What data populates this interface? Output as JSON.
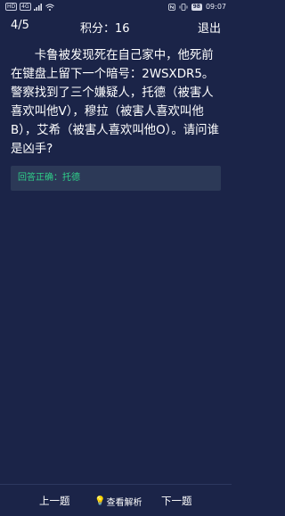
{
  "status_bar": {
    "left_tags": [
      "HD",
      "4G"
    ],
    "signal_icon": "signal-bars-icon",
    "wifi_icon": "wifi-icon",
    "nfc_icon": "nfc-icon",
    "vibrate_icon": "vibrate-icon",
    "battery": "98",
    "time": "09:07"
  },
  "top_bar": {
    "progress": "4/5",
    "score_label": "积分：",
    "score_value": "16",
    "exit_label": "退出"
  },
  "question": {
    "text": "卡鲁被发现死在自己家中，他死前在键盘上留下一个暗号：2WSXDR5。警察找到了三个嫌疑人，托德（被害人喜欢叫他V），穆拉（被害人喜欢叫他B），艾希（被害人喜欢叫他O）。请问谁是凶手?"
  },
  "answer": {
    "label": "回答正确：",
    "value": "托德",
    "color": "#2fd18a"
  },
  "bottom_bar": {
    "prev_label": "上一题",
    "analysis_label": "查看解析",
    "analysis_icon": "lightbulb-icon",
    "next_label": "下一题"
  },
  "colors": {
    "background": "#1b2448",
    "answer_background": "#2c3957"
  }
}
